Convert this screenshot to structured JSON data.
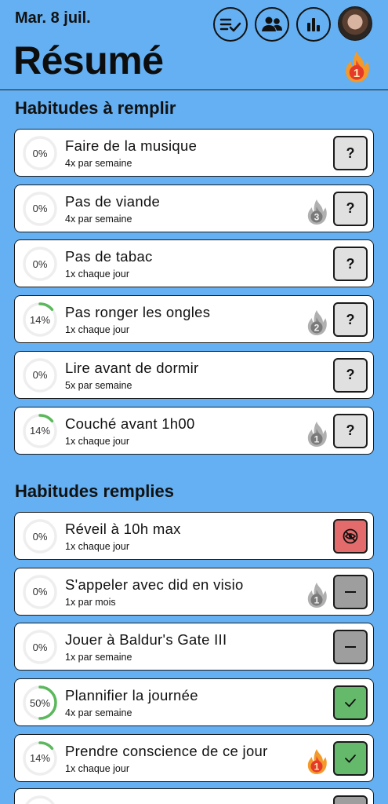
{
  "header": {
    "date": "Mar. 8 juil.",
    "title": "Résumé",
    "buttons": [
      {
        "name": "checklist-icon"
      },
      {
        "name": "group-icon"
      },
      {
        "name": "bar-chart-icon"
      }
    ],
    "streak": "1"
  },
  "sections": {
    "to_fill": "Habitudes à remplir",
    "filled": "Habitudes remplies"
  },
  "habits_to_fill": [
    {
      "pct": "0%",
      "progress": 0,
      "name": "Faire de la musique",
      "freq": "4x par semaine",
      "streak": "",
      "state": "?"
    },
    {
      "pct": "0%",
      "progress": 0,
      "name": "Pas de viande",
      "freq": "4x par semaine",
      "streak": "3",
      "state": "?"
    },
    {
      "pct": "0%",
      "progress": 0,
      "name": "Pas de tabac",
      "freq": "1x chaque jour",
      "streak": "",
      "state": "?"
    },
    {
      "pct": "14%",
      "progress": 0.14,
      "name": "Pas ronger les ongles",
      "freq": "1x chaque jour",
      "streak": "2",
      "state": "?"
    },
    {
      "pct": "0%",
      "progress": 0,
      "name": "Lire avant de dormir",
      "freq": "5x par semaine",
      "streak": "",
      "state": "?"
    },
    {
      "pct": "14%",
      "progress": 0.14,
      "name": "Couché avant 1h00",
      "freq": "1x chaque jour",
      "streak": "1",
      "state": "?"
    }
  ],
  "habits_filled": [
    {
      "pct": "0%",
      "progress": 0,
      "name": "Réveil à 10h max",
      "freq": "1x chaque jour",
      "streak": "",
      "status": "failed"
    },
    {
      "pct": "0%",
      "progress": 0,
      "name": "S'appeler avec did en visio",
      "freq": "1x par mois",
      "streak": "1",
      "status": "skipped"
    },
    {
      "pct": "0%",
      "progress": 0,
      "name": "Jouer à Baldur's Gate III",
      "freq": "1x par semaine",
      "streak": "",
      "status": "skipped"
    },
    {
      "pct": "50%",
      "progress": 0.5,
      "name": "Plannifier la journée",
      "freq": "4x par semaine",
      "streak": "",
      "status": "done"
    },
    {
      "pct": "14%",
      "progress": 0.14,
      "name": "Prendre conscience de ce jour",
      "freq": "1x chaque jour",
      "streak": "1",
      "status": "done",
      "streak_active": true
    }
  ],
  "colors": {
    "background": "#64b0f2",
    "progress": "#5cb85c",
    "ring_track": "#eeeeee",
    "failed": "#e46b6b",
    "skipped": "#9e9e9e",
    "done": "#65b96a",
    "unknown": "#e0e0e0"
  }
}
